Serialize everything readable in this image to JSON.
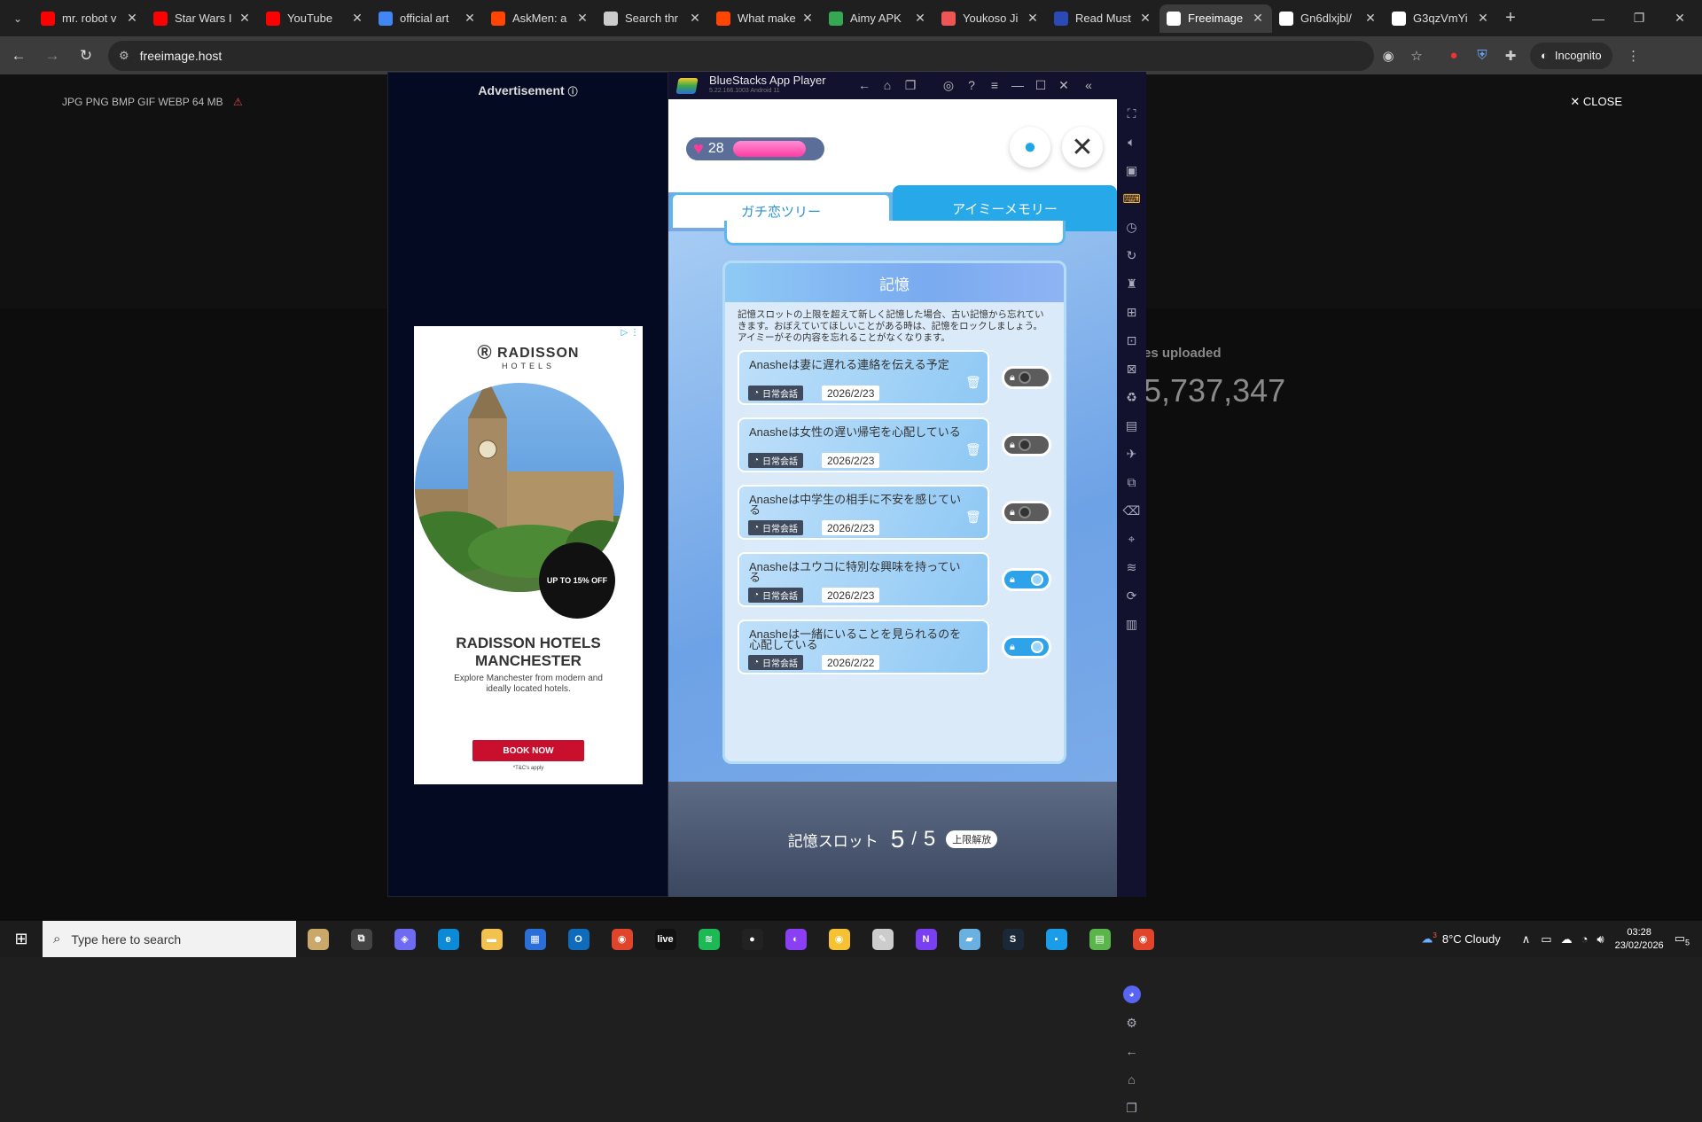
{
  "browser": {
    "tabs": [
      {
        "title": "mr. robot v",
        "icon": "youtube-icon",
        "color": "#ff0000"
      },
      {
        "title": "Star Wars I",
        "icon": "youtube-icon",
        "color": "#ff0000"
      },
      {
        "title": "YouTube",
        "icon": "youtube-icon",
        "color": "#ff0000"
      },
      {
        "title": "official art",
        "icon": "google-icon",
        "color": "#4285f4"
      },
      {
        "title": "AskMen: a",
        "icon": "reddit-icon",
        "color": "#ff4500"
      },
      {
        "title": "Search thr",
        "icon": "shield-icon",
        "color": "#cccccc"
      },
      {
        "title": "What make",
        "icon": "reddit-icon",
        "color": "#ff4500"
      },
      {
        "title": "Aimy APK",
        "icon": "aimy-icon",
        "color": "#34a853"
      },
      {
        "title": "Youkoso Ji",
        "icon": "manga-icon",
        "color": "#e55"
      },
      {
        "title": "Read Must",
        "icon": "book-icon",
        "color": "#2a4ab8"
      },
      {
        "title": "Freeimage",
        "icon": "freeimage-icon",
        "color": "#ffffff",
        "active": true
      },
      {
        "title": "Gn6dlxjbl/",
        "icon": "x-icon",
        "color": "#ffffff"
      },
      {
        "title": "G3qzVmYi",
        "icon": "x-icon",
        "color": "#ffffff"
      }
    ],
    "url": "freeimage.host",
    "incognito_label": "Incognito"
  },
  "page": {
    "file_info": "JPG PNG BMP GIF WEBP   64 MB",
    "close_label": "CLOSE",
    "uploaded_label": "es uploaded",
    "uploaded_count": "5,737,347"
  },
  "ad": {
    "label": "Advertisement",
    "brand": "RADISSON",
    "brand_sub": "HOTELS",
    "offer": "UP TO 15% OFF",
    "title": "RADISSON HOTELS MANCHESTER",
    "subtitle": "Explore Manchester from modern and ideally located hotels.",
    "cta": "BOOK NOW",
    "fineprint": "*T&C's apply"
  },
  "bluestacks": {
    "title": "BlueStacks App Player",
    "version": "5.22.166.1003  Android 11"
  },
  "game": {
    "hearts": "28",
    "tabs": [
      "ガチ恋ツリー",
      "アイミーメモリー"
    ],
    "active_tab": 1,
    "memory_header": "記憶",
    "memory_desc": "記憶スロットの上限を超えて新しく記憶した場合、古い記憶から忘れていきます。おぼえていてほしいことがある時は、記憶をロックしましょう。アイミーがその内容を忘れることがなくなります。",
    "memories": [
      {
        "text": "Anasheは妻に遅れる連絡を伝える予定",
        "tag": "日常会話",
        "date": "2026/2/23",
        "locked": false
      },
      {
        "text": "Anasheは女性の遅い帰宅を心配している",
        "tag": "日常会話",
        "date": "2026/2/23",
        "locked": false
      },
      {
        "text": "Anasheは中学生の相手に不安を感じている",
        "tag": "日常会話",
        "date": "2026/2/23",
        "locked": false
      },
      {
        "text": "Anasheはユウコに特別な興味を持っている",
        "tag": "日常会話",
        "date": "2026/2/23",
        "locked": true
      },
      {
        "text": "Anasheは一緒にいることを見られるのを心配している",
        "tag": "日常会話",
        "date": "2026/2/22",
        "locked": true
      }
    ],
    "slot_label": "記憶スロット",
    "slot_used": "5",
    "slot_sep": "/",
    "slot_max": "5",
    "unlock_label": "上限解放"
  },
  "taskbar": {
    "search_placeholder": "Type here to search",
    "weather": "8°C  Cloudy",
    "weather_badge": "3",
    "time": "03:28",
    "date": "23/02/2026",
    "notifications": "5"
  }
}
